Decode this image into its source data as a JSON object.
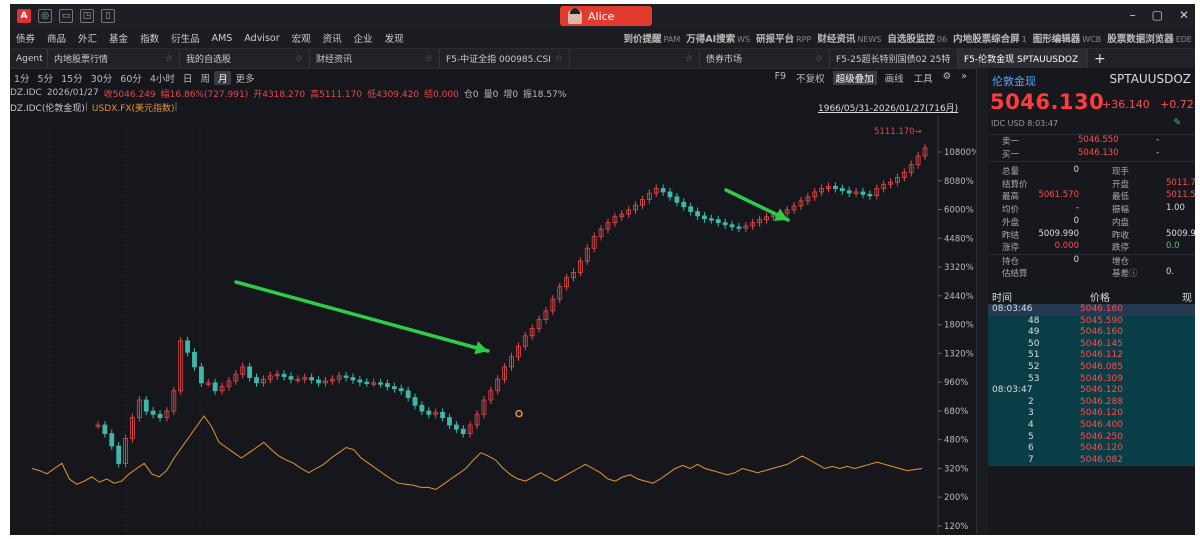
{
  "user": {
    "name": "Alice"
  },
  "titlebar": {
    "icons": [
      "A",
      "◎",
      "▭",
      "◳",
      "▯"
    ],
    "controls": [
      "–",
      "▢",
      "✕"
    ]
  },
  "menu": {
    "left": [
      "债券",
      "商品",
      "外汇",
      "基金",
      "指数",
      "衍生品",
      "AMS",
      "Advisor",
      "宏观",
      "资讯",
      "企业",
      "发现"
    ],
    "right": [
      {
        "label": "到价提醒",
        "tag": "PAM"
      },
      {
        "label": "万得AI搜索",
        "tag": "WS"
      },
      {
        "label": "研报平台",
        "tag": "RPP"
      },
      {
        "label": "财经资讯",
        "tag": "NEWS"
      },
      {
        "label": "自选股监控",
        "tag": "06"
      },
      {
        "label": "内地股票综合屏",
        "tag": "1"
      },
      {
        "label": "图形编辑器",
        "tag": "WCB"
      },
      {
        "label": "股票数据浏览器",
        "tag": "EDE"
      }
    ]
  },
  "tabs": [
    {
      "label": "Agent",
      "w": 38
    },
    {
      "label": "内地股票行情",
      "w": 132
    },
    {
      "label": "我的自选股",
      "w": 130
    },
    {
      "label": "财经资讯",
      "w": 130
    },
    {
      "label": "F5-中证全指 000985.CSI",
      "w": 130
    },
    {
      "label": "",
      "w": 130
    },
    {
      "label": "债券市场",
      "w": 130
    },
    {
      "label": "F5-25超长特别国债02 25特",
      "w": 128
    },
    {
      "label": "F5-伦敦金现 SPTAUUSDOZ",
      "w": 130,
      "active": true
    }
  ],
  "periods": {
    "items": [
      "1分",
      "5分",
      "15分",
      "30分",
      "60分",
      "4小时",
      "日",
      "周",
      "月",
      "更多"
    ],
    "selected": "月",
    "tools": [
      "F9",
      "不复权",
      "超级叠加",
      "画线",
      "工具",
      "⚙",
      "»"
    ]
  },
  "ohlc": {
    "code": "DZ.IDC",
    "date": "2026/01/27",
    "close": "收5046.249",
    "change": "幅16.86%(727.991)",
    "open": "开4318.270",
    "high": "高5111.170",
    "low": "低4309.420",
    "settle": "结0.000",
    "oi": "仓0",
    "vol": "量0",
    "inc": "增0",
    "amp": "振18.57%"
  },
  "legend": {
    "a": "DZ.IDC(伦敦金现)",
    "b": "USDX.FX(美元指数)"
  },
  "range": "1966/05/31-2026/01/27(716月)",
  "chart_data": {
    "type": "line",
    "axis": {
      "y_labels": [
        "10800%",
        "8080%",
        "6000%",
        "4480%",
        "3320%",
        "2440%",
        "1800%",
        "1320%",
        "960%",
        "680%",
        "480%",
        "320%",
        "200%",
        "120%"
      ],
      "scale": "log"
    },
    "high_label": "5111.170→",
    "series": [
      {
        "name": "伦敦金现",
        "color": "#e34a4a",
        "values": [
          70,
          60,
          48,
          35,
          55,
          80,
          110,
          90,
          85,
          80,
          90,
          130,
          320,
          260,
          200,
          150,
          150,
          130,
          140,
          155,
          175,
          200,
          165,
          150,
          160,
          170,
          175,
          168,
          160,
          160,
          165,
          158,
          150,
          155,
          160,
          170,
          165,
          158,
          152,
          150,
          150,
          148,
          140,
          135,
          130,
          115,
          100,
          90,
          85,
          88,
          80,
          70,
          65,
          60,
          70,
          85,
          110,
          130,
          160,
          200,
          240,
          290,
          350,
          400,
          470,
          550,
          680,
          850,
          1000,
          1100,
          1350,
          1700,
          2100,
          2400,
          2700,
          3000,
          3150,
          3400,
          3700,
          4100,
          4600,
          5000,
          4700,
          4300,
          3900,
          3600,
          3300,
          3050,
          2900,
          2850,
          2700,
          2600,
          2500,
          2450,
          2550,
          2700,
          2850,
          3000,
          3100,
          3200,
          3400,
          3650,
          4000,
          4300,
          4700,
          5000,
          5200,
          5000,
          4800,
          4600,
          4700,
          4500,
          4400,
          5000,
          5400,
          5600,
          6100,
          6700,
          7700,
          9000,
          10400
        ]
      },
      {
        "name": "美元指数",
        "color": "#e9952f",
        "values": [
          100,
          98,
          95,
          100,
          105,
          90,
          85,
          88,
          92,
          87,
          90,
          86,
          88,
          95,
          100,
          105,
          95,
          92,
          98,
          110,
          120,
          130,
          140,
          150,
          140,
          125,
          120,
          115,
          110,
          115,
          120,
          125,
          118,
          112,
          108,
          105,
          100,
          96,
          100,
          104,
          110,
          115,
          120,
          118,
          110,
          105,
          100,
          95,
          90,
          86,
          85,
          84,
          82,
          82,
          80,
          85,
          90,
          95,
          100,
          108,
          115,
          112,
          108,
          100,
          94,
          90,
          88,
          92,
          96,
          92,
          88,
          92,
          96,
          100,
          104,
          100,
          96,
          90,
          88,
          92,
          94,
          90,
          88,
          86,
          90,
          95,
          100,
          103,
          100,
          104,
          100,
          98,
          96,
          94,
          96,
          100,
          98,
          96,
          98,
          100,
          102,
          104,
          108,
          112,
          108,
          104,
          100,
          102,
          100,
          102,
          100,
          102,
          104,
          106,
          104,
          102,
          100,
          98,
          99,
          100
        ]
      }
    ]
  },
  "panel": {
    "name": "伦敦金现",
    "code": "SPTAUUSDOZ",
    "price": "5046.130",
    "change": "+36.140",
    "pct": "+0.72",
    "info": "IDC  USD  8:03:47",
    "edit": "✎",
    "sell1": {
      "label": "卖一",
      "value": "5046.550",
      "vol": "-"
    },
    "buy1": {
      "label": "买一",
      "value": "5046.130",
      "vol": "-"
    },
    "stats": [
      {
        "l1": "总量",
        "v1": "0",
        "c1": "v",
        "l2": "现手",
        "v2": "",
        "c2": "v"
      },
      {
        "l1": "结算价",
        "v1": "",
        "c1": "v",
        "l2": "开盘",
        "v2": "5011.7",
        "c2": "vr"
      },
      {
        "l1": "最高",
        "v1": "5061.570",
        "c1": "vr",
        "l2": "最低",
        "v2": "5011.5",
        "c2": "vr"
      },
      {
        "l1": "均价",
        "v1": "-",
        "c1": "v",
        "l2": "振幅",
        "v2": "1.00",
        "c2": "v"
      },
      {
        "l1": "外盘",
        "v1": "0",
        "c1": "v",
        "l2": "内盘",
        "v2": "",
        "c2": "v"
      },
      {
        "l1": "昨结",
        "v1": "5009.990",
        "c1": "v",
        "l2": "昨收",
        "v2": "5009.9",
        "c2": "v"
      },
      {
        "l1": "涨停",
        "v1": "0.000",
        "c1": "vr",
        "l2": "跌停",
        "v2": "0.0",
        "c2": "vg"
      },
      {
        "l1": "持仓",
        "v1": "0",
        "c1": "v",
        "l2": "增仓",
        "v2": "",
        "c2": "v"
      },
      {
        "l1": "估结算",
        "v1": "",
        "c1": "v",
        "l2": "基差ⓘ",
        "v2": "0.",
        "c2": "v"
      }
    ],
    "tick_head": {
      "time": "时间",
      "price": "价格",
      "extra": "现"
    },
    "ticks": [
      {
        "t": "08:03:46",
        "p": "5046.160"
      },
      {
        "t": "48",
        "p": "5045.590"
      },
      {
        "t": "49",
        "p": "5046.160"
      },
      {
        "t": "50",
        "p": "5046.145"
      },
      {
        "t": "51",
        "p": "5046.112"
      },
      {
        "t": "52",
        "p": "5046.085"
      },
      {
        "t": "53",
        "p": "5046.309"
      },
      {
        "t": "08:03:47",
        "p": "5046.120"
      },
      {
        "t": "2",
        "p": "5046.288"
      },
      {
        "t": "3",
        "p": "5046.120"
      },
      {
        "t": "4",
        "p": "5046.400"
      },
      {
        "t": "5",
        "p": "5046.250"
      },
      {
        "t": "6",
        "p": "5046.120"
      },
      {
        "t": "7",
        "p": "5046.082"
      }
    ]
  }
}
